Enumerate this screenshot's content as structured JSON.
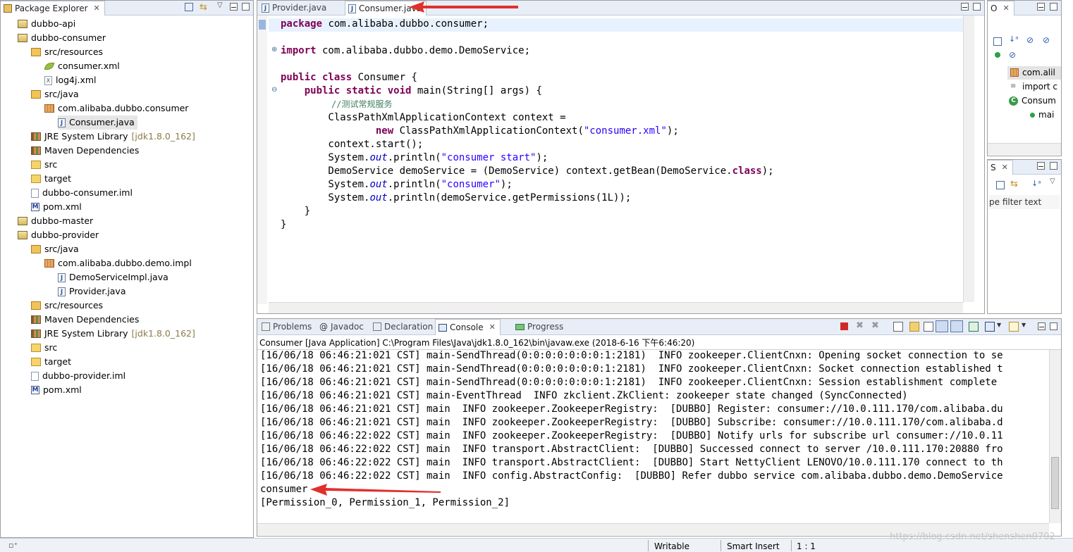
{
  "package_explorer": {
    "title": "Package Explorer",
    "items": [
      {
        "label": "dubbo-api",
        "icon": "maven-project-icon",
        "depth": 0
      },
      {
        "label": "dubbo-consumer",
        "icon": "maven-project-icon",
        "depth": 0
      },
      {
        "label": "src/resources",
        "icon": "source-folder-icon",
        "depth": 1
      },
      {
        "label": "consumer.xml",
        "icon": "spring-xml-icon",
        "depth": 2
      },
      {
        "label": "log4j.xml",
        "icon": "xml-file-icon",
        "depth": 2
      },
      {
        "label": "src/java",
        "icon": "source-folder-icon",
        "depth": 1
      },
      {
        "label": "com.alibaba.dubbo.consumer",
        "icon": "package-icon",
        "depth": 2
      },
      {
        "label": "Consumer.java",
        "icon": "java-file-icon",
        "depth": 3,
        "selected": true
      },
      {
        "label": "JRE System Library",
        "decoration": "[jdk1.8.0_162]",
        "icon": "library-icon",
        "depth": 1
      },
      {
        "label": "Maven Dependencies",
        "icon": "library-icon",
        "depth": 1
      },
      {
        "label": "src",
        "icon": "folder-icon",
        "depth": 1
      },
      {
        "label": "target",
        "icon": "folder-icon",
        "depth": 1
      },
      {
        "label": "dubbo-consumer.iml",
        "icon": "file-icon",
        "depth": 1
      },
      {
        "label": "pom.xml",
        "icon": "maven-pom-icon",
        "depth": 1
      },
      {
        "label": "dubbo-master",
        "icon": "maven-project-icon",
        "depth": 0
      },
      {
        "label": "dubbo-provider",
        "icon": "maven-project-icon",
        "depth": 0
      },
      {
        "label": "src/java",
        "icon": "source-folder-icon",
        "depth": 1
      },
      {
        "label": "com.alibaba.dubbo.demo.impl",
        "icon": "package-icon",
        "depth": 2
      },
      {
        "label": "DemoServiceImpl.java",
        "icon": "java-file-icon",
        "depth": 3
      },
      {
        "label": "Provider.java",
        "icon": "java-file-icon",
        "depth": 3
      },
      {
        "label": "src/resources",
        "icon": "source-folder-icon",
        "depth": 1
      },
      {
        "label": "Maven Dependencies",
        "icon": "library-icon",
        "depth": 1
      },
      {
        "label": "JRE System Library",
        "decoration": "[jdk1.8.0_162]",
        "icon": "library-icon",
        "depth": 1
      },
      {
        "label": "src",
        "icon": "folder-icon",
        "depth": 1
      },
      {
        "label": "target",
        "icon": "folder-icon",
        "depth": 1
      },
      {
        "label": "dubbo-provider.iml",
        "icon": "file-icon",
        "depth": 1
      },
      {
        "label": "pom.xml",
        "icon": "maven-pom-icon",
        "depth": 1
      }
    ]
  },
  "editor": {
    "tabs": [
      {
        "label": "Provider.java",
        "active": false
      },
      {
        "label": "Consumer.java",
        "active": true
      }
    ],
    "code": {
      "l1_kw": "package",
      "l1_rest": " com.alibaba.dubbo.consumer;",
      "l2_kw": "import",
      "l2_rest": " com.alibaba.dubbo.demo.DemoService;",
      "l3_kw": "public class",
      "l3_rest": " Consumer {",
      "l4_indent": "    ",
      "l4_kw": "public static void",
      "l4_rest": " main(String[] args) {",
      "l5_comment": "//测试常规服务",
      "l6": "        ClassPathXmlApplicationContext context =",
      "l7_indent": "                ",
      "l7_kw": "new",
      "l7_mid": " ClassPathXmlApplicationContext(",
      "l7_str": "\"consumer.xml\"",
      "l7_end": ");",
      "l8": "        context.start();",
      "l9_a": "        System.",
      "l9_it": "out",
      "l9_b": ".println(",
      "l9_str": "\"consumer start\"",
      "l9_c": ");",
      "l10_a": "        DemoService demoService = (DemoService) context.getBean(DemoService.",
      "l10_kw": "class",
      "l10_b": ");",
      "l11_a": "        System.",
      "l11_it": "out",
      "l11_b": ".println(",
      "l11_str": "\"consumer\"",
      "l11_c": ");",
      "l12_a": "        System.",
      "l12_it": "out",
      "l12_b": ".println(demoService.getPermissions(1L));",
      "l13": "    }",
      "l14": "}"
    }
  },
  "outline": {
    "title": "O",
    "items": [
      {
        "label": "com.alil",
        "icon": "package-decl-icon"
      },
      {
        "label": "import c",
        "icon": "imports-icon"
      },
      {
        "label": "Consum",
        "icon": "class-icon"
      },
      {
        "label": "mai",
        "icon": "method-icon"
      }
    ]
  },
  "second_view": {
    "title": "S",
    "filter_placeholder": "pe filter text"
  },
  "bottom": {
    "tabs": [
      {
        "label": "Problems",
        "icon": "problems-icon"
      },
      {
        "label": "Javadoc",
        "icon": "javadoc-icon"
      },
      {
        "label": "Declaration",
        "icon": "declaration-icon"
      },
      {
        "label": "Console",
        "icon": "console-icon",
        "active": true
      },
      {
        "label": "Progress",
        "icon": "progress-icon"
      }
    ],
    "console_header": "Consumer [Java Application] C:\\Program Files\\Java\\jdk1.8.0_162\\bin\\javaw.exe (2018-6-16 下午6:46:20)",
    "lines": [
      "[16/06/18 06:46:21:021 CST] main-SendThread(0:0:0:0:0:0:0:1:2181)  INFO zookeeper.ClientCnxn: Opening socket connection to se",
      "[16/06/18 06:46:21:021 CST] main-SendThread(0:0:0:0:0:0:0:1:2181)  INFO zookeeper.ClientCnxn: Socket connection established t",
      "[16/06/18 06:46:21:021 CST] main-SendThread(0:0:0:0:0:0:0:1:2181)  INFO zookeeper.ClientCnxn: Session establishment complete",
      "[16/06/18 06:46:21:021 CST] main-EventThread  INFO zkclient.ZkClient: zookeeper state changed (SyncConnected)",
      "[16/06/18 06:46:21:021 CST] main  INFO zookeeper.ZookeeperRegistry:  [DUBBO] Register: consumer://10.0.111.170/com.alibaba.du",
      "[16/06/18 06:46:21:021 CST] main  INFO zookeeper.ZookeeperRegistry:  [DUBBO] Subscribe: consumer://10.0.111.170/com.alibaba.d",
      "[16/06/18 06:46:22:022 CST] main  INFO zookeeper.ZookeeperRegistry:  [DUBBO] Notify urls for subscribe url consumer://10.0.11",
      "[16/06/18 06:46:22:022 CST] main  INFO transport.AbstractClient:  [DUBBO] Successed connect to server /10.0.111.170:20880 fro",
      "[16/06/18 06:46:22:022 CST] main  INFO transport.AbstractClient:  [DUBBO] Start NettyClient LENOVO/10.0.111.170 connect to th",
      "[16/06/18 06:46:22:022 CST] main  INFO config.AbstractConfig:  [DUBBO] Refer dubbo service com.alibaba.dubbo.demo.DemoService",
      "consumer",
      "[Permission_0, Permission_1, Permission_2]"
    ]
  },
  "status": {
    "writable": "Writable",
    "insert_mode": "Smart Insert",
    "position": "1 : 1",
    "watermark": "https://blog.csdn.net/shenshen0702"
  },
  "colors": {
    "annotation_arrow": "#e0302c",
    "tab_bar": "#e8eef8",
    "keyword": "#7f0055",
    "string": "#2a00ff"
  }
}
